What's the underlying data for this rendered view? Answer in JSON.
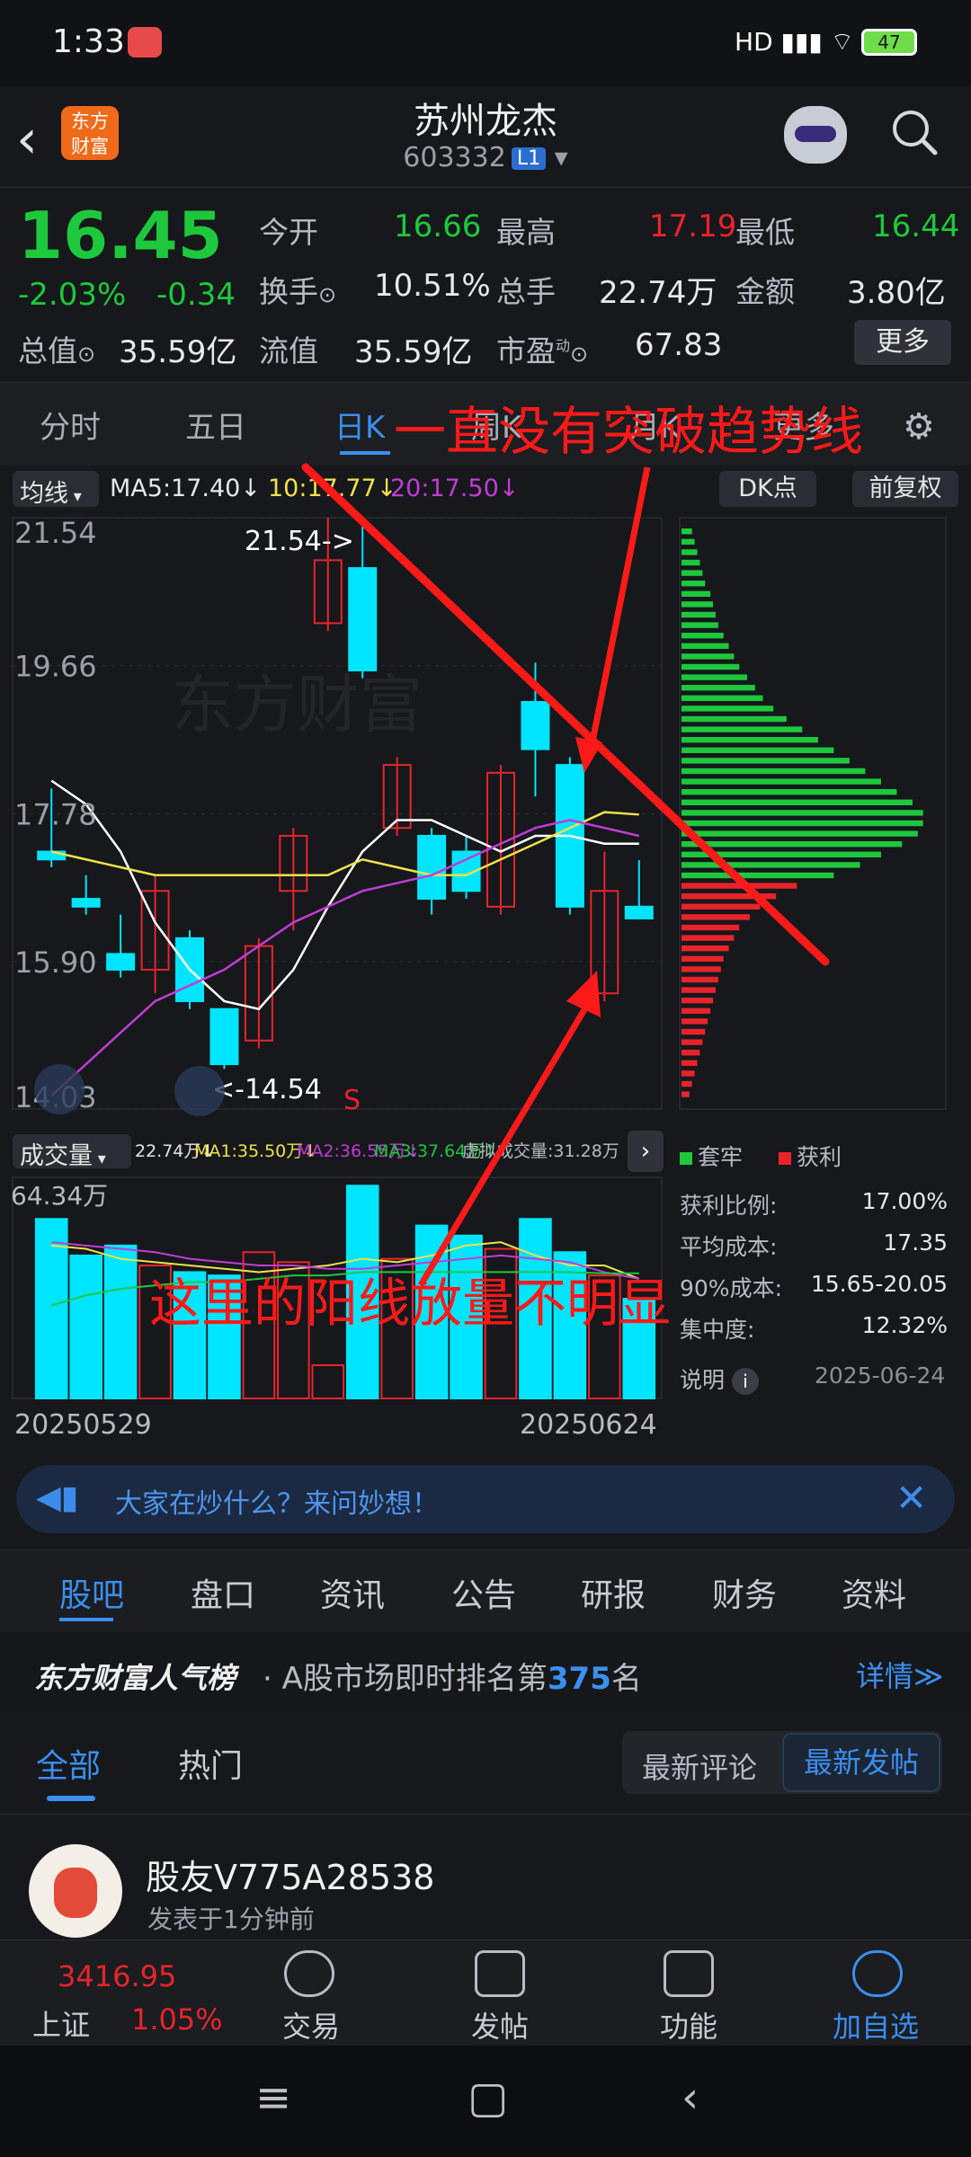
{
  "status": {
    "time": "1:33",
    "battery": "47",
    "signal": "HD"
  },
  "header": {
    "logo": "东方\n财富",
    "stock_name": "苏州龙杰",
    "stock_code": "603332",
    "level": "L1"
  },
  "quote": {
    "price": "16.45",
    "change_pct": "-2.03%",
    "change": "-0.34",
    "open_label": "今开",
    "open": "16.66",
    "high_label": "最高",
    "high": "17.19",
    "low_label": "最低",
    "low": "16.44",
    "turnover_label": "换手",
    "turnover": "10.51%",
    "volume_label": "总手",
    "volume": "22.74万",
    "amount_label": "金额",
    "amount": "3.80亿",
    "mcap_label": "总值",
    "mcap": "35.59亿",
    "float_label": "流值",
    "float": "35.59亿",
    "pe_label": "市盈",
    "pe_sup": "动",
    "pe": "67.83",
    "more": "更多"
  },
  "chart_tabs": {
    "items": [
      "分时",
      "五日",
      "日K",
      "周K",
      "月K",
      "更多"
    ]
  },
  "ma": {
    "label": "均线",
    "ma5": "MA5:17.40↓",
    "ma10": "10:17.77↓",
    "ma20": "20:17.50↓",
    "dk": "DK点",
    "fq": "前复权"
  },
  "annotations": {
    "top": "一直没有突破趋势线",
    "bottom": "这里的阳线放量不明显",
    "hi_mark": "21.54->",
    "lo_mark": "<-14.54",
    "s_mark": "S"
  },
  "volume": {
    "label": "成交量",
    "vol": "22.74万↓",
    "ma1": "MA1:35.50万↓",
    "ma2": "MA2:36.55万↓",
    "ma3": "MA3:37.64万↑",
    "virtual": "虚拟成交量:31.28万",
    "y_top": "64.34万"
  },
  "chip": {
    "legend_trap": "套牢",
    "legend_profit": "获利",
    "rows": [
      {
        "label": "获利比例:",
        "value": "17.00%"
      },
      {
        "label": "平均成本:",
        "value": "17.35"
      },
      {
        "label": "90%成本:",
        "value": "15.65-20.05"
      },
      {
        "label": "集中度:",
        "value": "12.32%"
      }
    ],
    "note": "说明",
    "date": "2025-06-24"
  },
  "dates": {
    "start": "20250529",
    "end": "20250624"
  },
  "banner": {
    "text": "大家在炒什么？来问妙想！"
  },
  "info_tabs": {
    "items": [
      "股吧",
      "盘口",
      "资讯",
      "公告",
      "研报",
      "财务",
      "资料"
    ]
  },
  "popularity": {
    "title": "东方财富人气榜",
    "prefix": "· A股市场即时排名第",
    "rank": "375",
    "suffix": "名",
    "detail": "详情≫"
  },
  "sub_tabs": {
    "all": "全部",
    "hot": "热门",
    "latest_comment": "最新评论",
    "latest_post": "最新发帖"
  },
  "post": {
    "user": "股友V775A28538",
    "time": "发表于1分钟前"
  },
  "bottom_nav": {
    "index_value": "3416.95",
    "index_name": "上证",
    "index_pct": "1.05%",
    "trade": "交易",
    "post": "发帖",
    "func": "功能",
    "add": "加自选"
  },
  "colors": {
    "up": "#e8242b",
    "down": "#1ec83c",
    "accent": "#3b8ff0",
    "bg": "#16181c"
  },
  "chart_data": {
    "type": "candlestick",
    "y_ticks": [
      "21.54",
      "19.66",
      "17.78",
      "15.90",
      "14.03"
    ],
    "ylim": [
      14.03,
      21.54
    ],
    "candles": [
      {
        "o": 17.3,
        "c": 17.2,
        "h": 18.1,
        "l": 17.1
      },
      {
        "o": 16.7,
        "c": 16.6,
        "h": 17.0,
        "l": 16.5
      },
      {
        "o": 16.0,
        "c": 15.8,
        "h": 16.5,
        "l": 15.7
      },
      {
        "o": 15.8,
        "c": 16.8,
        "h": 17.0,
        "l": 15.5
      },
      {
        "o": 16.2,
        "c": 15.4,
        "h": 16.3,
        "l": 15.3
      },
      {
        "o": 15.3,
        "c": 14.6,
        "h": 15.3,
        "l": 14.54
      },
      {
        "o": 14.9,
        "c": 16.1,
        "h": 16.2,
        "l": 14.8
      },
      {
        "o": 16.8,
        "c": 17.5,
        "h": 17.6,
        "l": 16.3
      },
      {
        "o": 20.2,
        "c": 21.0,
        "h": 21.54,
        "l": 20.1
      },
      {
        "o": 20.9,
        "c": 19.6,
        "h": 21.54,
        "l": 19.5
      },
      {
        "o": 17.6,
        "c": 18.4,
        "h": 18.5,
        "l": 17.5
      },
      {
        "o": 17.5,
        "c": 16.7,
        "h": 17.6,
        "l": 16.5
      },
      {
        "o": 17.3,
        "c": 16.8,
        "h": 17.5,
        "l": 16.7
      },
      {
        "o": 16.6,
        "c": 18.3,
        "h": 18.4,
        "l": 16.5
      },
      {
        "o": 19.2,
        "c": 18.6,
        "h": 19.7,
        "l": 18.0
      },
      {
        "o": 18.4,
        "c": 16.6,
        "h": 18.5,
        "l": 16.5
      },
      {
        "o": 15.5,
        "c": 16.8,
        "h": 17.3,
        "l": 15.4
      },
      {
        "o": 16.6,
        "c": 16.45,
        "h": 17.19,
        "l": 16.44
      }
    ],
    "ma5": [
      18.2,
      17.9,
      17.3,
      16.4,
      15.8,
      15.4,
      15.3,
      15.8,
      16.6,
      17.3,
      17.7,
      17.7,
      17.5,
      17.3,
      17.5,
      17.5,
      17.4,
      17.4
    ],
    "ma10": [
      17.3,
      17.2,
      17.1,
      17.0,
      17.0,
      17.0,
      17.0,
      17.0,
      17.0,
      17.2,
      17.1,
      17.0,
      17.0,
      17.2,
      17.4,
      17.6,
      17.8,
      17.77
    ],
    "ma20": [
      14.2,
      14.6,
      15.0,
      15.4,
      15.6,
      15.8,
      16.1,
      16.4,
      16.6,
      16.8,
      16.9,
      17.0,
      17.2,
      17.4,
      17.6,
      17.7,
      17.6,
      17.5
    ],
    "volume_ymax": 64.34,
    "volumes": [
      54,
      43,
      46,
      40,
      38,
      37,
      44,
      41,
      10,
      64,
      42,
      52,
      49,
      45,
      54,
      44,
      37,
      30
    ],
    "vol_ma1": [
      46,
      45,
      42,
      41,
      40,
      39,
      38,
      39,
      40,
      42,
      41,
      43,
      46,
      47,
      43,
      40,
      40,
      36
    ],
    "vol_ma2": [
      47,
      46,
      45,
      44,
      42,
      41,
      40,
      40,
      39,
      39,
      40,
      41,
      42,
      43,
      42,
      41,
      38,
      36
    ],
    "vol_ma3": [
      28,
      31,
      33,
      34,
      35,
      35,
      36,
      37,
      37,
      38,
      38,
      38,
      38,
      38,
      38,
      38,
      37.64,
      37.64
    ],
    "chip_profile": {
      "trap": [
        4,
        5,
        6,
        7,
        8,
        9,
        11,
        12,
        13,
        14,
        16,
        18,
        20,
        22,
        25,
        28,
        31,
        35,
        40,
        46,
        52,
        58,
        64,
        70,
        76,
        82,
        88,
        92,
        92,
        90,
        84,
        76,
        68,
        58
      ],
      "profit": [
        44,
        36,
        30,
        26,
        22,
        20,
        18,
        16,
        15,
        14,
        13,
        12,
        11,
        10,
        9,
        8,
        7,
        6,
        5,
        4,
        3
      ]
    }
  }
}
